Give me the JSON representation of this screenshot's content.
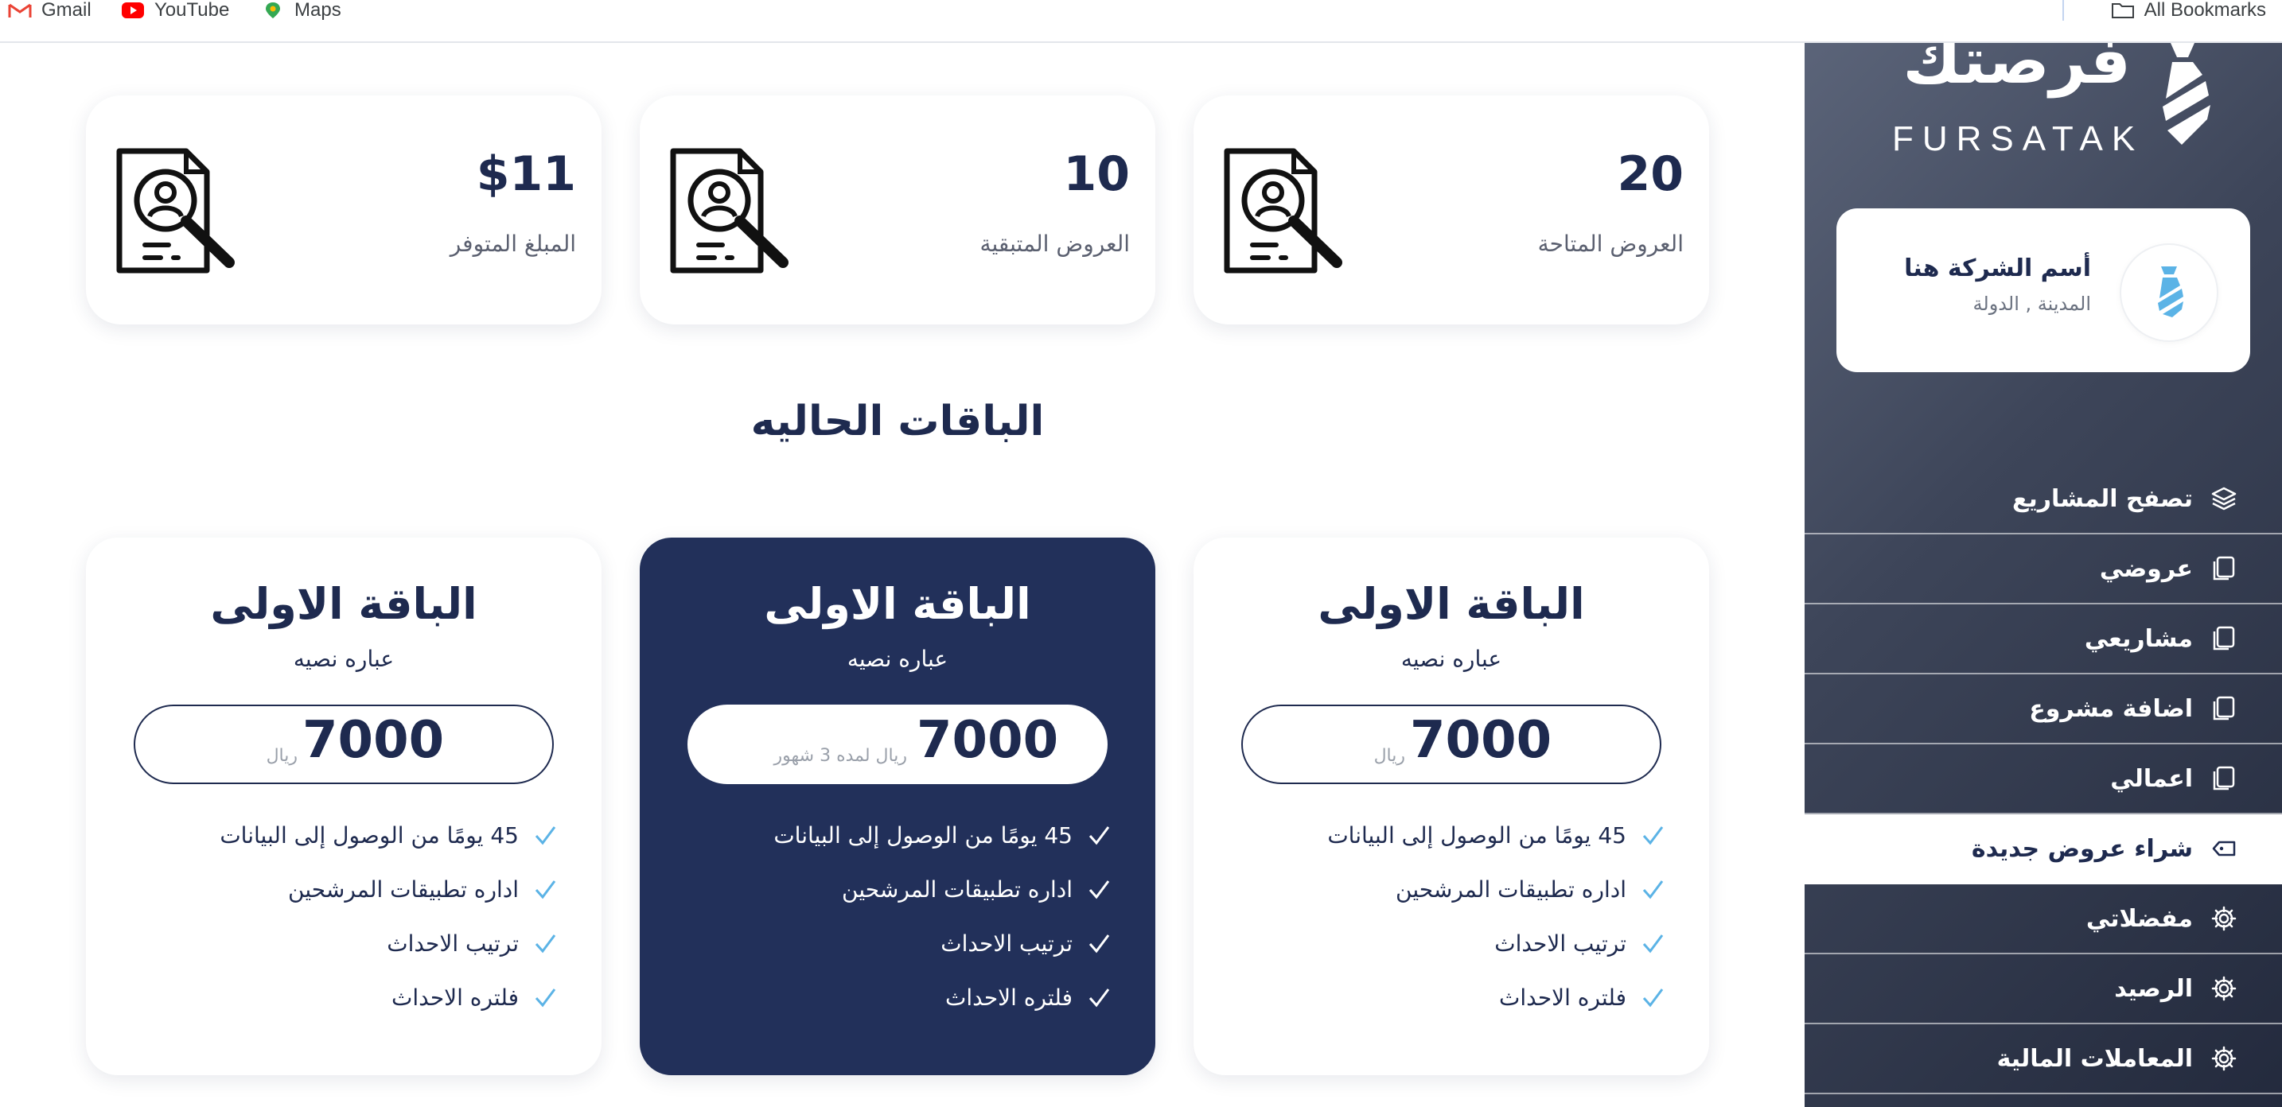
{
  "bookmarks": {
    "items": [
      {
        "label": "Gmail",
        "icon": "gmail-icon"
      },
      {
        "label": "YouTube",
        "icon": "youtube-icon"
      },
      {
        "label": "Maps",
        "icon": "maps-icon"
      }
    ],
    "all_label": "All Bookmarks"
  },
  "sidebar": {
    "logo_ar": "فرصتك",
    "logo_en": "FURSATAK",
    "company_name": "أسم الشركة هنا",
    "company_location": "المدينة , الدولة",
    "menu": [
      {
        "label": "تصفح المشاريع",
        "icon": "layers-icon",
        "active": false
      },
      {
        "label": "عروضي",
        "icon": "document-icon",
        "active": false
      },
      {
        "label": "مشاريعي",
        "icon": "document-icon",
        "active": false
      },
      {
        "label": "اضافة مشروع",
        "icon": "document-icon",
        "active": false
      },
      {
        "label": "اعمالي",
        "icon": "document-icon",
        "active": false
      },
      {
        "label": "شراء عروض جديدة",
        "icon": "tag-icon",
        "active": true
      },
      {
        "label": "مفضلاتي",
        "icon": "gear-icon",
        "active": false
      },
      {
        "label": "الرصيد",
        "icon": "gear-icon",
        "active": false
      },
      {
        "label": "المعاملات المالية",
        "icon": "gear-icon",
        "active": false
      }
    ]
  },
  "stats": [
    {
      "value": "20",
      "label": "العروض المتاحة",
      "icon": "resume-search-icon"
    },
    {
      "value": "10",
      "label": "العروض المتبقية",
      "icon": "resume-search-icon"
    },
    {
      "value": "$11",
      "label": "المبلغ المتوفر",
      "icon": "resume-search-icon"
    }
  ],
  "section_title": "الباقات الحاليه",
  "packages": [
    {
      "title": "الباقة الاولى",
      "subtitle": "عباره نصيه",
      "price": "7000",
      "unit": "ريال",
      "featured": false,
      "features": [
        "45 يومًا من الوصول إلى البيانات",
        "اداره تطبيقات المرشحين",
        "ترتيب الاحداث",
        "فلتره الاحداث"
      ]
    },
    {
      "title": "الباقة الاولى",
      "subtitle": "عباره نصيه",
      "price": "7000",
      "unit": "ريال لمده 3 شهور",
      "featured": true,
      "features": [
        "45 يومًا من الوصول إلى البيانات",
        "اداره تطبيقات المرشحين",
        "ترتيب الاحداث",
        "فلتره الاحداث"
      ]
    },
    {
      "title": "الباقة الاولى",
      "subtitle": "عباره نصيه",
      "price": "7000",
      "unit": "ريال",
      "featured": false,
      "features": [
        "45 يومًا من الوصول إلى البيانات",
        "اداره تطبيقات المرشحين",
        "ترتيب الاحداث",
        "فلتره الاحداث"
      ]
    }
  ],
  "colors": {
    "navy": "#1e2a4f",
    "featured_bg": "#22305a",
    "check_blue": "#5bb3e6",
    "sidebar_dark": "#232a3d"
  }
}
